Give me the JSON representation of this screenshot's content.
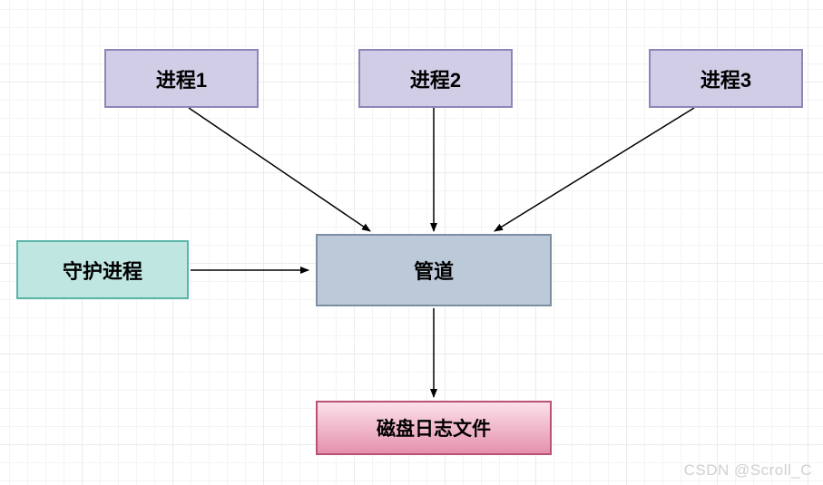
{
  "nodes": {
    "process1": "进程1",
    "process2": "进程2",
    "process3": "进程3",
    "daemon": "守护进程",
    "pipe": "管道",
    "diskLog": "磁盘日志文件"
  },
  "watermark": "CSDN @Scroll_C"
}
